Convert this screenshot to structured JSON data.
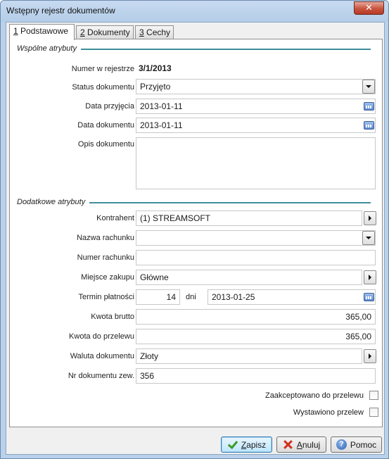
{
  "window": {
    "title": "Wstępny rejestr dokumentów",
    "close_glyph": "✕"
  },
  "tabs": [
    {
      "number": "1",
      "label": "Podstawowe",
      "active": true
    },
    {
      "number": "2",
      "label": "Dokumenty",
      "active": false
    },
    {
      "number": "3",
      "label": "Cechy",
      "active": false
    }
  ],
  "sections": {
    "common": "Wspólne atrybuty",
    "additional": "Dodatkowe atrybuty"
  },
  "fields": {
    "register_number": {
      "label": "Numer w rejestrze",
      "value": "3/1/2013"
    },
    "status": {
      "label": "Status dokumentu",
      "value": "Przyjęto"
    },
    "receipt_date": {
      "label": "Data przyjęcia",
      "value": "2013-01-11"
    },
    "document_date": {
      "label": "Data dokumentu",
      "value": "2013-01-11"
    },
    "description": {
      "label": "Opis dokumentu",
      "value": ""
    },
    "contractor": {
      "label": "Kontrahent",
      "value": "(1) STREAMSOFT"
    },
    "account_name": {
      "label": "Nazwa rachunku",
      "value": ""
    },
    "account_number": {
      "label": "Numer rachunku",
      "value": ""
    },
    "purchase_place": {
      "label": "Miejsce zakupu",
      "value": "Główne"
    },
    "payment_term": {
      "label": "Termin płatności",
      "days": "14",
      "days_unit": "dni",
      "date": "2013-01-25"
    },
    "gross_amount": {
      "label": "Kwota brutto",
      "value": "365,00"
    },
    "transfer_amount": {
      "label": "Kwota do przelewu",
      "value": "365,00"
    },
    "currency": {
      "label": "Waluta dokumentu",
      "value": "Złoty"
    },
    "external_number": {
      "label": "Nr dokumentu zew.",
      "value": "356"
    }
  },
  "checkboxes": {
    "accepted_for_transfer": {
      "label": "Zaakceptowano do przelewu",
      "checked": false
    },
    "transfer_issued": {
      "label": "Wystawiono przelew",
      "checked": false
    }
  },
  "buttons": {
    "save": {
      "mnemonic": "Z",
      "rest": "apisz"
    },
    "cancel": {
      "mnemonic": "A",
      "rest": "nuluj"
    },
    "help": {
      "label": "Pomoc"
    }
  },
  "colors": {
    "section_line": "#3f8f9a",
    "window_frame": "#b9d1ea",
    "close_button": "#c7543f"
  }
}
